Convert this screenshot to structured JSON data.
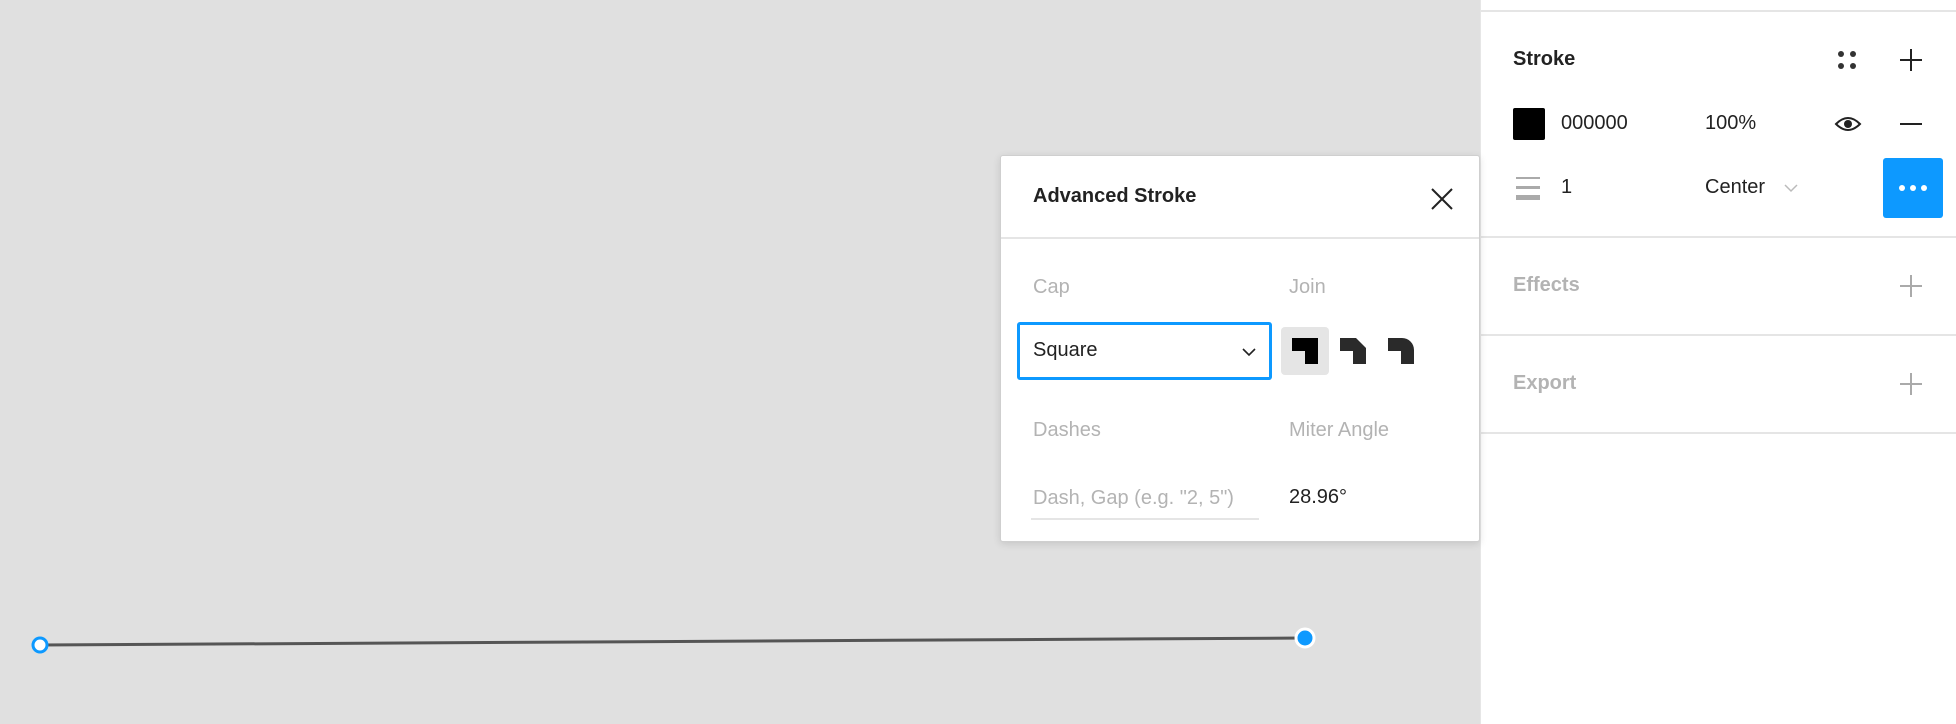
{
  "canvas": {
    "selection_color": "#0d99ff",
    "line_color": "#555555"
  },
  "panel": {
    "stroke": {
      "title": "Stroke",
      "color_hex": "000000",
      "swatch_color": "#000000",
      "opacity": "100%",
      "weight": "1",
      "align": "Center",
      "icons": [
        "styles-icon",
        "plus-icon",
        "eye-icon",
        "minus-icon",
        "stroke-weight-icon",
        "more-icon"
      ]
    },
    "effects": {
      "title": "Effects"
    },
    "export": {
      "title": "Export"
    }
  },
  "popover": {
    "title": "Advanced Stroke",
    "cap_label": "Cap",
    "cap_value": "Square",
    "join_label": "Join",
    "join_options": [
      "miter",
      "bevel",
      "round"
    ],
    "join_selected": "miter",
    "dashes_label": "Dashes",
    "dashes_placeholder": "Dash, Gap (e.g. \"2, 5\")",
    "miter_label": "Miter Angle",
    "miter_value": "28.96°"
  },
  "accent": "#0d99ff"
}
